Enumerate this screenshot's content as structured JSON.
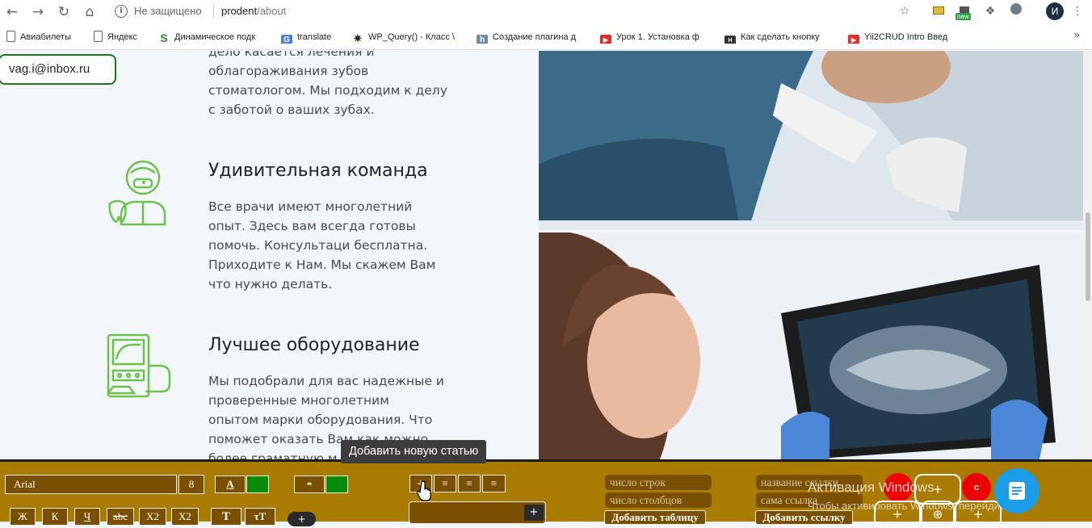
{
  "browser": {
    "security_label": "Не защищено",
    "url_host": "prodent",
    "url_path": "/about",
    "avatar_letter": "И",
    "new_badge": "new"
  },
  "bookmarks": [
    {
      "label": "Авиабилеты"
    },
    {
      "label": "Яндекс"
    },
    {
      "label": "Динамическое подк"
    },
    {
      "label": "translate"
    },
    {
      "label": "WP_Query() - Класс \\"
    },
    {
      "label": "Создание плагина д"
    },
    {
      "label": "Урок 1. Установка ф"
    },
    {
      "label": "Как сделать кнопку"
    },
    {
      "label": "Yii2CRUD Intro Введ"
    }
  ],
  "page": {
    "email": "vag.i@inbox.ru",
    "intro_lines": [
      "дело касается лечения и",
      "облагораживания зубов",
      "стоматологом. Мы подходим к делу",
      "с заботой о ваших зубах."
    ],
    "features": [
      {
        "title": "Удивительная команда",
        "lines": [
          "Все врачи имеют многолетний",
          "опыт. Здесь вам всегда готовы",
          "помочь. Консультаци бесплатна.",
          "Приходите к Нам. Мы скажем Вам",
          "что нужно делать."
        ]
      },
      {
        "title": "Лучшее оборудование",
        "lines": [
          "Мы подобрали для вас надежные и",
          "проверенные многолетним",
          "опытом марки оборудования. Что",
          "поможет оказать Вам как можно",
          "более граматную м"
        ]
      }
    ]
  },
  "tooltip": "Добавить новую статью",
  "editor": {
    "font_name": "Arial",
    "font_size": "8",
    "format_buttons": [
      "Ж",
      "К",
      "Ч",
      "abc",
      "X2",
      "X2"
    ],
    "table_rows_placeholder": "число строк",
    "table_cols_placeholder": "число столбцов",
    "add_table_label": "Добавить таблицу",
    "link_name_placeholder": "название ссылки",
    "link_self_placeholder": "сама ссылка",
    "add_link_label": "Добавить ссылку",
    "red_button_label": "с"
  },
  "watermark": {
    "line1": "Активация Windows",
    "line2": "Чтобы активировать Windows, перейдите в"
  },
  "colors": {
    "toolbar_bg": "#a97b00",
    "accent_green": "#0a8a0a",
    "icon_green": "#6cc24a",
    "chat_blue": "#1c9de8"
  }
}
